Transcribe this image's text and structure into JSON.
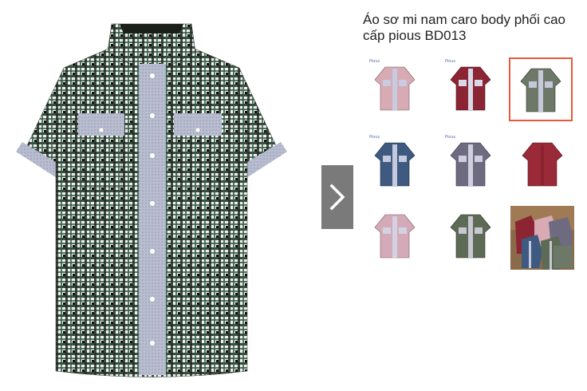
{
  "product": {
    "title": "Áo sơ mi nam caro body phối cao cấp pious BD013",
    "brand_label": "Pious"
  },
  "gallery": {
    "main_image": "green-white-plaid-shirt",
    "next_icon": "chevron-right-icon",
    "selected_index": 2,
    "thumbnails": [
      {
        "name": "thumb-red-white-plaid",
        "color": "#d8aab4",
        "placket": "#c9cbe0"
      },
      {
        "name": "thumb-burgundy-shirt",
        "color": "#8b2433",
        "placket": "#d8d8e6"
      },
      {
        "name": "thumb-green-plaid",
        "color": "#6d7868",
        "placket": "#c5c8d8"
      },
      {
        "name": "thumb-blue-plaid",
        "color": "#3e5a80",
        "placket": "#c5c9dd"
      },
      {
        "name": "thumb-gray-purple-plaid",
        "color": "#6e6a80",
        "placket": "#cfcfe0"
      },
      {
        "name": "thumb-dark-red-shirt",
        "color": "#9a2a38",
        "placket": "#9a2a38"
      },
      {
        "name": "thumb-pink-white-plaid",
        "color": "#d5aab8",
        "placket": "#d2d2e2"
      },
      {
        "name": "thumb-olive-plaid",
        "color": "#5d6a55",
        "placket": "#c8c8d2"
      },
      {
        "name": "thumb-shirts-bundle-photo",
        "color": "#8b6a4a",
        "placket": "#c8c8d2"
      }
    ]
  },
  "colors": {
    "selected_border": "#e55a3c",
    "next_button_bg": "#7a7a7a",
    "shirt_dark": "#1f2a22",
    "shirt_green": "#2e5a3f",
    "shirt_light": "#e9ecef",
    "chambray": "#b8bccd"
  }
}
